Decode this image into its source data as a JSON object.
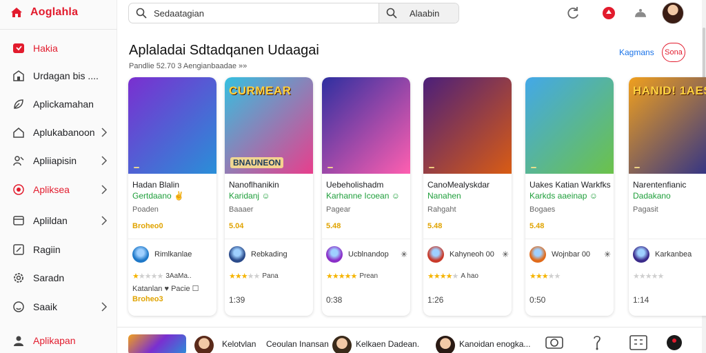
{
  "brand": {
    "label": "Aoglahla",
    "color": "#e21b2d"
  },
  "sidebar": {
    "items": [
      {
        "label": "Hakia",
        "icon": "app-store-icon",
        "chevron": false,
        "red": true
      },
      {
        "label": "Urdagan bis ....",
        "icon": "storefront-icon",
        "chevron": false,
        "red": false
      },
      {
        "label": "Aplickamahan",
        "icon": "leaf-icon",
        "chevron": false,
        "red": false
      },
      {
        "label": "Aplukabanoon",
        "icon": "home-icon",
        "chevron": true,
        "red": false
      },
      {
        "label": "Apliiapisin",
        "icon": "people-icon",
        "chevron": true,
        "red": false
      },
      {
        "label": "Apliksea",
        "icon": "target-icon",
        "chevron": true,
        "red": true
      },
      {
        "label": "Aplildan",
        "icon": "window-icon",
        "chevron": true,
        "red": false
      },
      {
        "label": "Ragiin",
        "icon": "edit-icon",
        "chevron": false,
        "red": false
      },
      {
        "label": "Saradn",
        "icon": "gear-icon",
        "chevron": false,
        "red": false
      },
      {
        "label": "Saaik",
        "icon": "smile-icon",
        "chevron": true,
        "red": false
      },
      {
        "label": "Aplikapan",
        "icon": "user-icon",
        "chevron": false,
        "red": true
      }
    ]
  },
  "search": {
    "value": "Sedaatagian",
    "button_label": "Alaabin"
  },
  "topbar": {
    "icons": [
      "refresh-icon",
      "notification-icon",
      "cloud-icon"
    ]
  },
  "section": {
    "title": "Aplaladai Sdtadqanen Udaagai",
    "subtitle": "Pandlie 52.70 3 Aengianbaadae »»",
    "see_more": "Kagmans",
    "sort": "Sona"
  },
  "cards": [
    {
      "art_text": "",
      "art_text2": "",
      "title_line1": "Hadan Blalin",
      "title_line2": "Gertdaano ✌",
      "category": "Poaden",
      "price": "Broheo0",
      "dev_name": "Rimlkanlae",
      "dev_more": "",
      "rating": 1,
      "rating_text": "3AaMa.. ",
      "extra1": "Katanlan ♥ Pacie ☐",
      "extra2": "Broheo3",
      "time": "",
      "colors": [
        "#7a2fd0",
        "#2a8fd8"
      ],
      "dev_color": "#1e78c8"
    },
    {
      "art_text": "CURMEAR",
      "art_text2": "BNAUNEON",
      "title_line1": "Nanoflhanikin",
      "title_line2": "Karidanj ☺",
      "category": "Baaaer",
      "price": "5.04",
      "dev_name": "Rebkading",
      "dev_more": "",
      "rating": 3,
      "rating_text": "Pana",
      "extra1": "",
      "extra2": "",
      "time": "1:39",
      "colors": [
        "#35c0e0",
        "#e83e8c"
      ],
      "dev_color": "#2a4a8a"
    },
    {
      "art_text": "",
      "art_text2": "",
      "title_line1": "Uebeholishadm",
      "title_line2": "Karhanne Icoean ☺",
      "category": "Pagear",
      "price": "5.48",
      "dev_name": "Ucblnandop",
      "dev_more": "✳",
      "rating": 5,
      "rating_text": "Prean",
      "extra1": "",
      "extra2": "",
      "time": "0:38",
      "colors": [
        "#2e2fa0",
        "#ff5fb0"
      ],
      "dev_color": "#8a2fc8"
    },
    {
      "art_text": "",
      "art_text2": "",
      "title_line1": "CanoMealyskdar",
      "title_line2": "Nanahen",
      "category": "Rahgaht",
      "price": "5.48",
      "dev_name": "Kahyneoh 00",
      "dev_more": "✳",
      "rating": 4,
      "rating_text": "A hao",
      "extra1": "",
      "extra2": "",
      "time": "1:26",
      "colors": [
        "#4b1f7a",
        "#d95c14"
      ],
      "dev_color": "#c93a2a"
    },
    {
      "art_text": "",
      "art_text2": "",
      "title_line1": "Uakes Katian Warkfks",
      "title_line2": "Karkds aaeinap ☺",
      "category": "Bogaes",
      "price": "5.48",
      "dev_name": "Wojnbar 00",
      "dev_more": "✳",
      "rating": 3,
      "rating_text": "",
      "extra1": "",
      "extra2": "",
      "time": "0:50",
      "colors": [
        "#43a8e8",
        "#6cc24a"
      ],
      "dev_color": "#e06a1a"
    },
    {
      "art_text": "HANID! 1AES",
      "art_text2": "",
      "title_line1": "Narentenfianic",
      "title_line2": "Dadakano",
      "category": "Pagasit",
      "price": "",
      "dev_name": "Karkanbea",
      "dev_more": "",
      "rating": 0,
      "rating_text": "",
      "extra1": "",
      "extra2": "",
      "time": "1:14",
      "colors": [
        "#f0a01e",
        "#2a2f8a"
      ],
      "dev_color": "#3a2a8a"
    }
  ],
  "bottom": {
    "label1": "Kelotvlan",
    "label2": "Ceoulan Inansan",
    "label3": "Kelkaen Dadean.",
    "label4": "Kanoidan enogka...",
    "icons": [
      "camera-icon",
      "share-icon",
      "grid-icon",
      "profile-icon"
    ]
  }
}
